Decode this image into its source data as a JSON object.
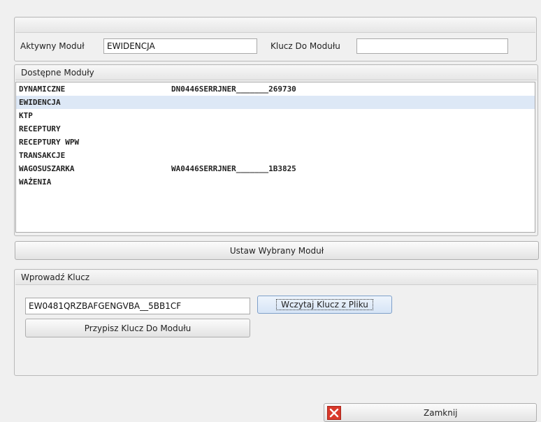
{
  "module_panel": {
    "active_label": "Aktywny Moduł",
    "active_value": "EWIDENCJA",
    "key_label": "Klucz Do Modułu",
    "key_value": ""
  },
  "available_modules": {
    "title": "Dostępne Moduły",
    "items": [
      {
        "name": "DYNAMICZNE",
        "key": "DN0446SERRJNER_______269730"
      },
      {
        "name": "EWIDENCJA",
        "key": ""
      },
      {
        "name": "KTP",
        "key": ""
      },
      {
        "name": "RECEPTURY",
        "key": ""
      },
      {
        "name": "RECEPTURY WPW",
        "key": ""
      },
      {
        "name": "TRANSAKCJE",
        "key": ""
      },
      {
        "name": "WAGOSUSZARKA",
        "key": "WA0446SERRJNER_______1B3825"
      },
      {
        "name": "WAŻENIA",
        "key": ""
      }
    ],
    "selected_index": 1
  },
  "set_module_button": "Ustaw Wybrany Moduł",
  "enter_key": {
    "title": "Wprowadź Klucz",
    "key_value": "EW0481QRZBAFGENGVBA__5BB1CF",
    "load_button": "Wczytaj Klucz z Pliku",
    "assign_button": "Przypisz Klucz Do Modułu"
  },
  "close_button": "Zamknij",
  "colors": {
    "selected_row": "#dde8f6",
    "close_icon_bg": "#d9392b"
  }
}
